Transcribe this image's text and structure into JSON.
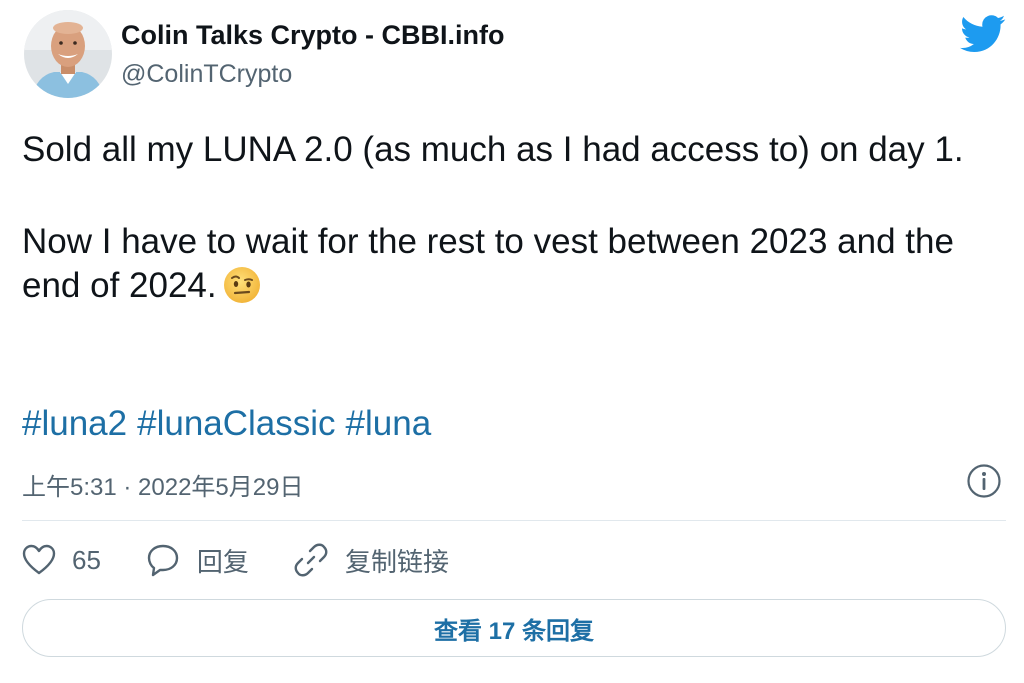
{
  "author": {
    "display_name": "Colin Talks Crypto - CBBI.info",
    "handle": "@ColinTCrypto",
    "avatar": "avatar-photo"
  },
  "brand": {
    "icon": "twitter-bird-icon",
    "color": "#1d9bf0"
  },
  "tweet": {
    "paragraph_1": "Sold all my LUNA 2.0 (as much as I had access to) on day 1.",
    "paragraph_2": "Now I have to wait for the rest to vest between 2023 and the end of 2024.",
    "emoji": "face-with-raised-eyebrow-emoji",
    "hashtags": [
      "#luna2",
      "#lunaClassic",
      "#luna"
    ],
    "hashtag_color": "#1d6fa5",
    "timestamp": "上午5:31 · 2022年5月29日"
  },
  "actions": {
    "like_count": "65",
    "reply_label": "回复",
    "copy_link_label": "复制链接"
  },
  "view_replies_label": "查看 17 条回复"
}
